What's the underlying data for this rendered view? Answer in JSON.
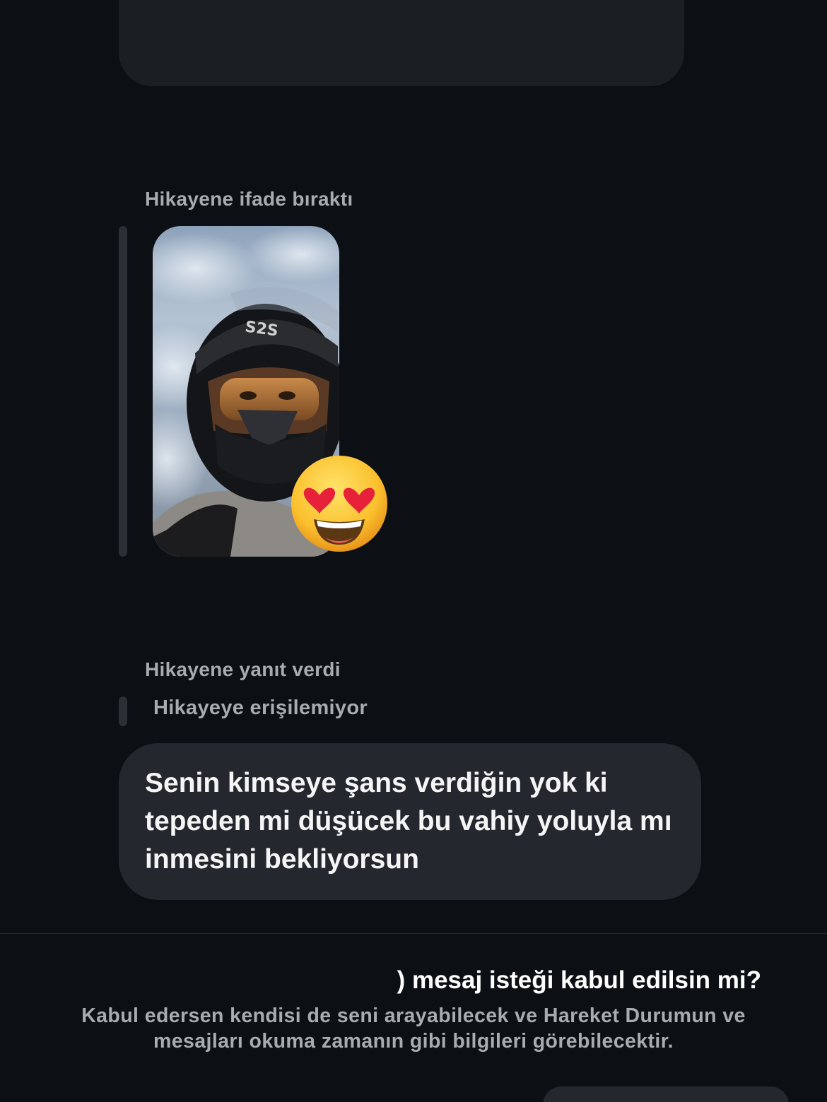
{
  "thread": {
    "reaction_label": "Hikayene ifade bıraktı",
    "reaction_emoji": "heart-eyes-emoji",
    "story_thumbnail": "person-with-motorcycle-helmet-selfie",
    "reply_label": "Hikayene yanıt verdi",
    "story_unavailable": "Hikayeye erişilemiyor",
    "message_text": "Senin kimseye şans verdiğin yok ki tepeden mi düşücek bu vahiy yoluyla mı inmesini bekliyorsun"
  },
  "request_banner": {
    "title": ") mesaj isteği kabul edilsin mi?",
    "description": "Kabul edersen kendisi de seni arayabilecek ve Hareket Durumun ve mesajları okuma zamanın gibi bilgileri görebilecektir."
  },
  "colors": {
    "background": "#0c1014",
    "bubble": "#24282e",
    "secondary_text": "#a8abb1"
  }
}
